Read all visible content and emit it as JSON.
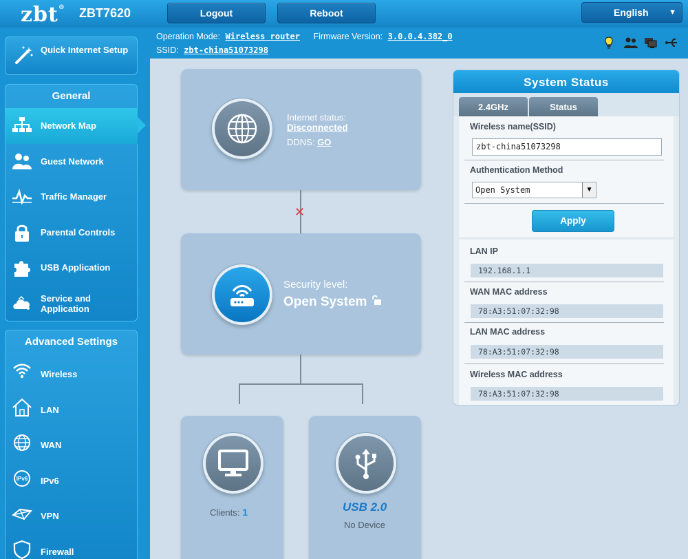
{
  "header": {
    "logo_text": "zbt",
    "logo_mark": "®",
    "model": "ZBT7620",
    "logout_label": "Logout",
    "reboot_label": "Reboot",
    "language": "English"
  },
  "info": {
    "operation_mode_label": "Operation Mode:",
    "operation_mode_value": "Wireless router",
    "firmware_label": "Firmware Version:",
    "firmware_value": "3.0.0.4.382_0",
    "ssid_label": "SSID:",
    "ssid_value": "zbt-china51073298"
  },
  "sidebar": {
    "quick_setup": "Quick Internet Setup",
    "general_title": "General",
    "general_items": [
      {
        "label": "Network Map",
        "icon": "network-map-icon"
      },
      {
        "label": "Guest Network",
        "icon": "guest-network-icon"
      },
      {
        "label": "Traffic Manager",
        "icon": "traffic-manager-icon"
      },
      {
        "label": "Parental Controls",
        "icon": "lock-icon"
      },
      {
        "label": "USB Application",
        "icon": "puzzle-icon"
      },
      {
        "label": "Service and Application",
        "icon": "cloud-icon"
      }
    ],
    "advanced_title": "Advanced Settings",
    "advanced_items": [
      {
        "label": "Wireless",
        "icon": "wifi-icon"
      },
      {
        "label": "LAN",
        "icon": "home-icon"
      },
      {
        "label": "WAN",
        "icon": "globe-icon"
      },
      {
        "label": "IPv6",
        "icon": "ipv6-icon"
      },
      {
        "label": "VPN",
        "icon": "vpn-icon"
      },
      {
        "label": "Firewall",
        "icon": "shield-icon"
      }
    ]
  },
  "map": {
    "internet_status_label": "Internet status:",
    "internet_status_value": "Disconnected",
    "ddns_label": "DDNS:",
    "ddns_link": "GO",
    "disconnect_mark": "✕",
    "security_label": "Security level:",
    "security_value": "Open System",
    "clients_label": "Clients:",
    "clients_count": "1",
    "usb_title": "USB 2.0",
    "usb_status": "No Device"
  },
  "system_status": {
    "title": "System Status",
    "tabs": [
      "2.4GHz",
      "Status"
    ],
    "ssid_label": "Wireless name(SSID)",
    "ssid_value": "zbt-china51073298",
    "auth_label": "Authentication Method",
    "auth_value": "Open System",
    "apply_label": "Apply",
    "lan_ip_label": "LAN IP",
    "lan_ip_value": "192.168.1.1",
    "wan_mac_label": "WAN MAC address",
    "wan_mac_value": "78:A3:51:07:32:98",
    "lan_mac_label": "LAN MAC address",
    "lan_mac_value": "78:A3:51:07:32:98",
    "wireless_mac_label": "Wireless MAC address",
    "wireless_mac_value": "78:A3:51:07:32:98"
  },
  "status_icons": [
    "usb-bulb-icon",
    "clients-icon",
    "devices-icon",
    "usb-icon"
  ],
  "colors": {
    "brand_blue": "#1a93d4",
    "main_bg": "#cfdeea",
    "card_bg": "#a9c4dc",
    "disconnect_red": "#e0343c",
    "usb_blue": "#1b78c4"
  }
}
